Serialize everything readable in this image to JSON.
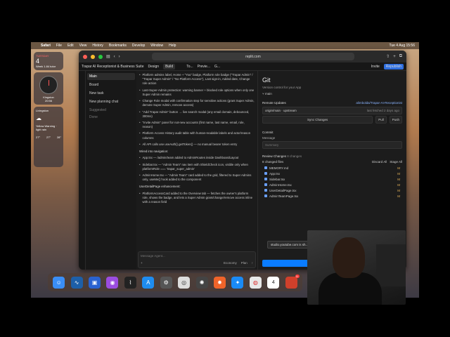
{
  "menubar": {
    "apple": "",
    "items": [
      "Safari",
      "File",
      "Edit",
      "View",
      "History",
      "Bookmarks",
      "Develop",
      "Window",
      "Help"
    ],
    "clock": "Tue 4 Aug 15:56"
  },
  "widgets": {
    "date_day": "TUESDAY",
    "date_num": "4",
    "event": "Week 1.84 tutor",
    "city1": "Kingston",
    "city1_time": "20:56",
    "city2": "Livingston",
    "note": "Yellow Warning · light rain",
    "temps": [
      "27°",
      "27°",
      "28°"
    ]
  },
  "browser": {
    "url": "replit.com"
  },
  "app": {
    "title": "Trapar AI Receptionist & Business Suite",
    "tabs": [
      "Design",
      "Build"
    ],
    "git_tabs": [
      "To...",
      "Previe...",
      "G..."
    ],
    "invite": "Invite",
    "republish": "Republish"
  },
  "sidebar": {
    "items": [
      "Main",
      "Board",
      "New task",
      "New planning chat"
    ],
    "suggested": "Suggested",
    "done": "Done"
  },
  "chat": {
    "paragraphs": [
      "Platform admins label, Home + \"You\" badge, Platform role badge (\"Trapar Admin\" / \"Trapar Super Admin\" / \"No Platform Access\"), Last sign-in, Added date, Change role action",
      "Last-Super-Admin protection: warning banner + blocked role options when only one Super Admin remains",
      "Change Role modal with confirmation step for sensitive actions (grant Super Admin, demote Super Admin, remove access)",
      "\"Add Trapar Admin\" button → live search modal (any email domain, debounced, 300ms)",
      "\"Invite Admin\" panel for not-new accounts (first name, last name, email, role, reason)",
      "Platform Access History audit table with human-readable labels and actor/reason columns",
      "All API calls use useAuth().getToken() — no manual bearer token entry"
    ],
    "section1": "Wired into navigation:",
    "nav_bullets": [
      "App.tsx — /admin/team added to AdminRoutes inside DashboardLayout",
      "Sidebar.tsx — \"Admin Team\" nav item with ShieldCheck icon, visible only when platformRole === 'trapar_super_admin'",
      "AdminHome.tsx — \"Admin Team\" card added to the grid, filtered to Super Admins only, useMe() hook added to the component"
    ],
    "section2": "UserDetailPage enhancement:",
    "detail_bullets": [
      "PlatformAccessCard added to the Overview tab — fetches the owner's platform role, shows the badge, and lets a Super Admin grant/change/remove access inline with a reason field"
    ],
    "placeholder": "Message Agent...",
    "mode": "Economy",
    "plan": "Plan"
  },
  "git": {
    "title": "Git",
    "subtitle": "Version control for your App",
    "branch": "main",
    "remote_label": "Remote Updates",
    "remote_repo": "alimbolda/Trapar-AI-Receptionist",
    "origin": "origin/main",
    "upstream": "upstream",
    "fetched": "last fetched 2 days ago",
    "sync": "Sync Changes",
    "pull": "Pull",
    "push": "Push",
    "commit_label": "Commit",
    "message_label": "Message",
    "summary_placeholder": "Summary",
    "review_label": "Review Changes",
    "changes_count": "8 changes",
    "changed_files": "8 changed files",
    "discard": "Discard All",
    "stage": "Stage All",
    "files": [
      "MEMORY.md",
      "App.tsx",
      "Sidebar.tsx",
      "AdminHome.tsx",
      "UserDetailPage.tsx",
      "AdminTeamPage.tsx"
    ],
    "commit_btn": "Commit"
  },
  "notice": "studio.youtube.com is sh...",
  "dock": {
    "icons": [
      "finder-icon",
      "wave-icon",
      "files-icon",
      "podcast-icon",
      "activity-icon",
      "appstore-icon",
      "gear-icon",
      "chrome-icon",
      "openai-icon",
      "settings-icon",
      "safari-icon",
      "chrome-icon",
      "calendar-icon",
      "mail-icon"
    ],
    "calendar_day": "4",
    "mail_badge": "11"
  },
  "colors": {
    "accent": "#2f6fe0",
    "push_accent": "#0a7cff"
  }
}
